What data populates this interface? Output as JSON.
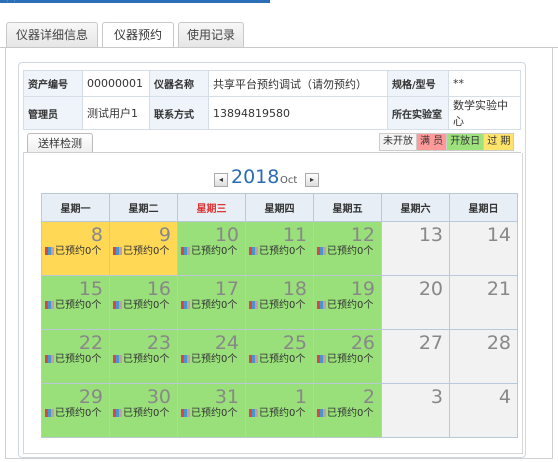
{
  "tabs": [
    "仪器详细信息",
    "仪器预约",
    "使用记录"
  ],
  "info": {
    "asset_no_label": "资产编号",
    "asset_no": "00000001",
    "name_label": "仪器名称",
    "name": "共享平台预约调试（请勿预约）",
    "spec_label": "规格/型号",
    "spec": "**",
    "manager_label": "管理员",
    "manager": "测试用户1",
    "contact_label": "联系方式",
    "contact": "13894819580",
    "lab_label": "所在实验室",
    "lab": "数学实验中心"
  },
  "subtab": "送样检测",
  "legend": [
    {
      "label": "未开放",
      "color": "#f4f4f4"
    },
    {
      "label": "满 员",
      "color": "#ff9a9a"
    },
    {
      "label": "开放日",
      "color": "#9ee27e"
    },
    {
      "label": "过 期",
      "color": "#ffe36a"
    }
  ],
  "calendar": {
    "prev": "◂",
    "next": "▸",
    "year": "2018",
    "month": "Oct",
    "weekdays": [
      "星期一",
      "星期二",
      "星期三",
      "星期四",
      "星期五",
      "星期六",
      "星期日"
    ],
    "highlight_weekday": 2,
    "booking_text": "已预约0个",
    "weeks": [
      [
        {
          "d": "8",
          "s": "yellow",
          "b": true
        },
        {
          "d": "9",
          "s": "yellow",
          "b": true
        },
        {
          "d": "10",
          "s": "green",
          "b": true
        },
        {
          "d": "11",
          "s": "green",
          "b": true
        },
        {
          "d": "12",
          "s": "green",
          "b": true
        },
        {
          "d": "13",
          "s": "grey",
          "b": false
        },
        {
          "d": "14",
          "s": "grey",
          "b": false
        }
      ],
      [
        {
          "d": "15",
          "s": "green",
          "b": true
        },
        {
          "d": "16",
          "s": "green",
          "b": true
        },
        {
          "d": "17",
          "s": "green",
          "b": true
        },
        {
          "d": "18",
          "s": "green",
          "b": true
        },
        {
          "d": "19",
          "s": "green",
          "b": true
        },
        {
          "d": "20",
          "s": "grey",
          "b": false
        },
        {
          "d": "21",
          "s": "grey",
          "b": false
        }
      ],
      [
        {
          "d": "22",
          "s": "green",
          "b": true
        },
        {
          "d": "23",
          "s": "green",
          "b": true
        },
        {
          "d": "24",
          "s": "green",
          "b": true
        },
        {
          "d": "25",
          "s": "green",
          "b": true
        },
        {
          "d": "26",
          "s": "green",
          "b": true
        },
        {
          "d": "27",
          "s": "grey",
          "b": false
        },
        {
          "d": "28",
          "s": "grey",
          "b": false
        }
      ],
      [
        {
          "d": "29",
          "s": "green",
          "b": true
        },
        {
          "d": "30",
          "s": "green",
          "b": true
        },
        {
          "d": "31",
          "s": "green",
          "b": true
        },
        {
          "d": "1",
          "s": "green",
          "b": true
        },
        {
          "d": "2",
          "s": "green",
          "b": true
        },
        {
          "d": "3",
          "s": "grey",
          "b": false
        },
        {
          "d": "4",
          "s": "grey",
          "b": false
        }
      ]
    ]
  }
}
